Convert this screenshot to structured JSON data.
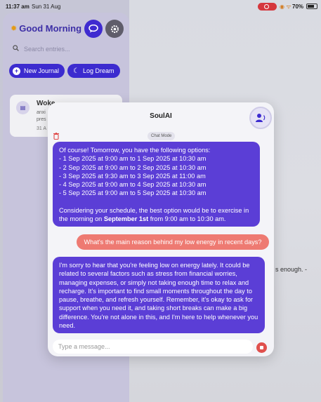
{
  "status_bar": {
    "time": "11:37 am",
    "date": "Sun 31 Aug",
    "battery": "70%"
  },
  "sidebar": {
    "greeting": "Good Morning",
    "search_placeholder": "Search entries...",
    "new_journal_label": "New Journal",
    "log_dream_label": "Log Dream",
    "entry": {
      "title": "Woke",
      "line1": "anxi",
      "line2": "pres",
      "date": "31 A"
    }
  },
  "background": {
    "snippet": "s enough. -"
  },
  "chat": {
    "title": "SoulAI",
    "mode_badge": "Chat Mode",
    "ai_message_1_lines": [
      "Of course! Tomorrow, you have the following options:",
      "- 1 Sep 2025 at 9:00 am to 1 Sep 2025 at 10:30 am",
      "- 2 Sep 2025 at 9:00 am to 2 Sep 2025 at 10:30 am",
      "- 3 Sep 2025 at 9:30 am to 3 Sep 2025 at 11:00 am",
      "- 4 Sep 2025 at 9:00 am to 4 Sep 2025 at 10:30 am",
      "- 5 Sep 2025 at 9:00 am to 5 Sep 2025 at 10:30 am",
      "",
      "Considering your schedule, the best option would be to exercise in"
    ],
    "ai_message_1_last_prefix": "the morning on ",
    "ai_message_1_last_bold": "September 1st",
    "ai_message_1_last_suffix": " from 9:00 am to 10:30 am.",
    "user_message": "What's the main reason behind my low energy in recent days?",
    "ai_message_2": "I'm sorry to hear that you're feeling low on energy lately. It could be related to several factors such as stress from financial worries, managing expenses, or simply not taking enough time to relax and recharge. It's important to find small moments throughout the day to pause, breathe, and refresh yourself. Remember, it's okay to ask for support when you need it, and taking short breaks can make a big difference. You're not alone in this, and I'm here to help whenever you need.",
    "input_placeholder": "Type a message..."
  },
  "colors": {
    "accent": "#3c2bcf",
    "ai_bubble": "#5b3ed6",
    "user_bubble": "#ee7a72",
    "danger": "#e0504d"
  },
  "icons": [
    "sun-icon",
    "chat-icon",
    "settings-icon",
    "search-icon",
    "plus-icon",
    "moon-icon",
    "journal-icon",
    "voice-icon",
    "trash-icon",
    "stop-icon"
  ]
}
